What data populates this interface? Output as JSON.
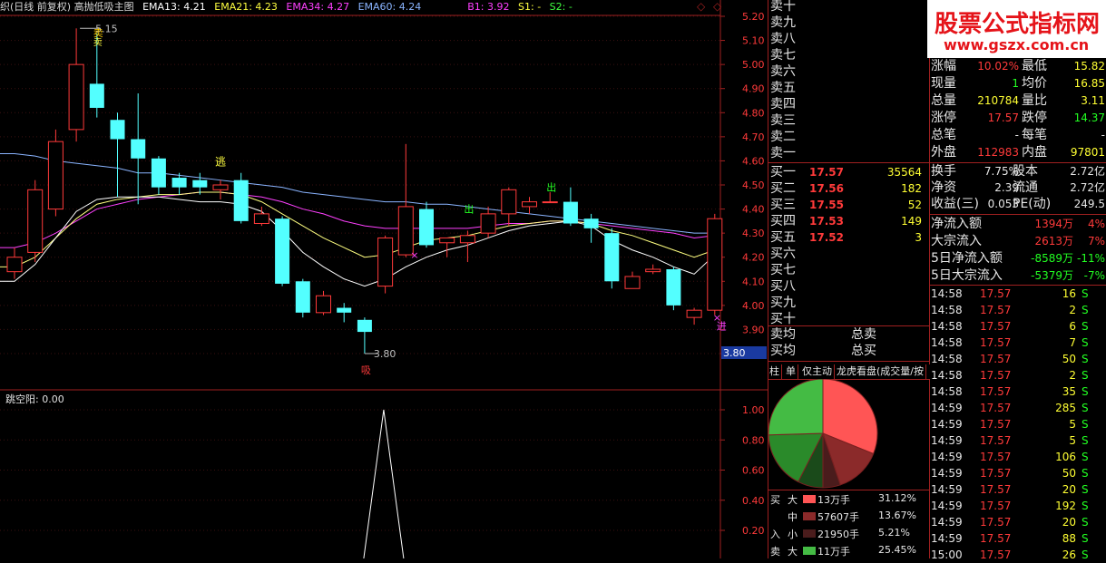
{
  "header": {
    "title": "织(日线 前复权) 高抛低吸主图",
    "indicators": [
      {
        "label": "EMA13: 4.21",
        "color": "#ffffff"
      },
      {
        "label": "EMA21: 4.23",
        "color": "#ffff40"
      },
      {
        "label": "EMA34: 4.27",
        "color": "#ff40ff"
      },
      {
        "label": "EMA60: 4.24",
        "color": "#8ab4ff"
      },
      {
        "label": "B1: 3.92",
        "color": "#ff40ff"
      },
      {
        "label": "S1: -",
        "color": "#ffff40"
      },
      {
        "label": "S2: -",
        "color": "#40ff40"
      }
    ],
    "diamond": "◇"
  },
  "price_axis": [
    "5.20",
    "5.10",
    "5.00",
    "4.90",
    "4.80",
    "4.70",
    "4.60",
    "4.50",
    "4.40",
    "4.30",
    "4.20",
    "4.10",
    "4.00",
    "3.90",
    "3.80"
  ],
  "current_price_tag": "3.80",
  "annotations": {
    "high_label": "5.15",
    "low_label": "3.80",
    "escape": "逃",
    "in_label": "进",
    "out1": "出",
    "out2": "出",
    "out3": "出",
    "sell_mark": "卖",
    "low_mark": "吸"
  },
  "lower": {
    "title": "跳空阳: 0.00",
    "axis": [
      "1.00",
      "0.80",
      "0.60",
      "0.40",
      "0.20"
    ]
  },
  "watermark": {
    "title": "股票公式指标网",
    "url": "www.gszx.com.cn"
  },
  "sell_labels": [
    "卖十",
    "卖九",
    "卖八",
    "卖七",
    "卖六",
    "卖五",
    "卖四",
    "卖三",
    "卖二",
    "卖一"
  ],
  "quote": [
    {
      "k1": "涨幅",
      "v1": "10.02%",
      "k2": "最低",
      "v2": "15.82"
    },
    {
      "k1": "现量",
      "v1": "1",
      "k2": "均价",
      "v2": "16.85"
    },
    {
      "k1": "总量",
      "v1": "210784",
      "k2": "量比",
      "v2": "3.11"
    },
    {
      "k1": "涨停",
      "v1": "17.57",
      "k2": "跌停",
      "v2": "14.37"
    },
    {
      "k1": "总笔",
      "v1": "-",
      "k2": "每笔",
      "v2": "-"
    },
    {
      "k1": "外盘",
      "v1": "112983",
      "k2": "内盘",
      "v2": "97801"
    }
  ],
  "buy_book": [
    {
      "label": "买一",
      "price": "17.57",
      "vol": "35564"
    },
    {
      "label": "买二",
      "price": "17.56",
      "vol": "182"
    },
    {
      "label": "买三",
      "price": "17.55",
      "vol": "52"
    },
    {
      "label": "买四",
      "price": "17.53",
      "vol": "149"
    },
    {
      "label": "买五",
      "price": "17.52",
      "vol": "3"
    }
  ],
  "buy_more": [
    "买六",
    "买七",
    "买八",
    "买九",
    "买十"
  ],
  "avg": {
    "sell_avg": "卖均",
    "total_sell": "总卖",
    "buy_avg": "买均",
    "total_buy": "总买"
  },
  "fundamentals": [
    {
      "k1": "换手",
      "v1": "7.75%",
      "k2": "股本",
      "v2": "2.72亿"
    },
    {
      "k1": "净资",
      "v1": "2.39",
      "k2": "流通",
      "v2": "2.72亿"
    },
    {
      "k1": "收益(三)",
      "v1": "0.053",
      "k2": "PE(动)",
      "v2": "249.5"
    }
  ],
  "flows": [
    {
      "label": "净流入额",
      "value": "1394万",
      "pct": "4%",
      "color": "#ff3a3a"
    },
    {
      "label": "大宗流入",
      "value": "2613万",
      "pct": "7%",
      "color": "#ff3a3a"
    },
    {
      "label": "5日净流入额",
      "value": "-8589万",
      "pct": "-11%",
      "color": "#22ff22"
    },
    {
      "label": "5日大宗流入",
      "value": "-5379万",
      "pct": "-7%",
      "color": "#22ff22"
    }
  ],
  "ticks": [
    {
      "t": "14:58",
      "p": "17.57",
      "v": "16",
      "s": "S"
    },
    {
      "t": "14:58",
      "p": "17.57",
      "v": "2",
      "s": "S"
    },
    {
      "t": "14:58",
      "p": "17.57",
      "v": "6",
      "s": "S"
    },
    {
      "t": "14:58",
      "p": "17.57",
      "v": "7",
      "s": "S"
    },
    {
      "t": "14:58",
      "p": "17.57",
      "v": "50",
      "s": "S"
    },
    {
      "t": "14:58",
      "p": "17.57",
      "v": "2",
      "s": "S"
    },
    {
      "t": "14:58",
      "p": "17.57",
      "v": "35",
      "s": "S"
    },
    {
      "t": "14:59",
      "p": "17.57",
      "v": "285",
      "s": "S"
    },
    {
      "t": "14:59",
      "p": "17.57",
      "v": "5",
      "s": "S"
    },
    {
      "t": "14:59",
      "p": "17.57",
      "v": "5",
      "s": "S"
    },
    {
      "t": "14:59",
      "p": "17.57",
      "v": "106",
      "s": "S"
    },
    {
      "t": "14:59",
      "p": "17.57",
      "v": "50",
      "s": "S"
    },
    {
      "t": "14:59",
      "p": "17.57",
      "v": "20",
      "s": "S"
    },
    {
      "t": "14:59",
      "p": "17.57",
      "v": "192",
      "s": "S"
    },
    {
      "t": "14:59",
      "p": "17.57",
      "v": "20",
      "s": "S"
    },
    {
      "t": "14:59",
      "p": "17.57",
      "v": "88",
      "s": "S"
    },
    {
      "t": "15:00",
      "p": "17.57",
      "v": "26",
      "s": "S"
    }
  ],
  "tabs": [
    "柱",
    "单",
    "仅主动",
    "龙虎看盘(成交量/按"
  ],
  "pie": {
    "slices": [
      {
        "label": "大买",
        "value": 31.12,
        "color": "#ff5555"
      },
      {
        "label": "中买",
        "value": 13.67,
        "color": "#8b2a2a"
      },
      {
        "label": "小买",
        "value": 5.21,
        "color": "#4a1c1c"
      },
      {
        "label": "小卖",
        "value": 7.5,
        "color": "#1a4a1a"
      },
      {
        "label": "中卖",
        "value": 17.05,
        "color": "#2a8a2a"
      },
      {
        "label": "大卖",
        "value": 25.45,
        "color": "#44bb44"
      }
    ]
  },
  "legend": {
    "side_buy": "买",
    "side_in": "入",
    "side_sell": "卖",
    "rows": [
      {
        "size": "大",
        "amount": "13万手",
        "pct": "31.12%",
        "color": "#ff5555"
      },
      {
        "size": "中",
        "amount": "57607手",
        "pct": "13.67%",
        "color": "#8b2a2a"
      },
      {
        "size": "小",
        "amount": "21950手",
        "pct": "5.21%",
        "color": "#4a1c1c"
      },
      {
        "size": "大",
        "amount": "11万手",
        "pct": "25.45%",
        "color": "#44bb44"
      }
    ]
  },
  "candles": [
    {
      "o": 4.14,
      "c": 4.2,
      "h": 4.24,
      "l": 4.11
    },
    {
      "o": 4.22,
      "c": 4.48,
      "h": 4.52,
      "l": 4.18
    },
    {
      "o": 4.4,
      "c": 4.68,
      "h": 4.73,
      "l": 4.37
    },
    {
      "o": 4.73,
      "c": 5.0,
      "h": 5.15,
      "l": 4.68
    },
    {
      "o": 4.92,
      "c": 4.82,
      "h": 5.13,
      "l": 4.78
    },
    {
      "o": 4.77,
      "c": 4.69,
      "h": 4.8,
      "l": 4.45
    },
    {
      "o": 4.69,
      "c": 4.61,
      "h": 4.88,
      "l": 4.42
    },
    {
      "o": 4.61,
      "c": 4.49,
      "h": 4.62,
      "l": 4.46
    },
    {
      "o": 4.53,
      "c": 4.49,
      "h": 4.55,
      "l": 4.46
    },
    {
      "o": 4.52,
      "c": 4.49,
      "h": 4.55,
      "l": 4.46
    },
    {
      "o": 4.48,
      "c": 4.5,
      "h": 4.52,
      "l": 4.44
    },
    {
      "o": 4.52,
      "c": 4.35,
      "h": 4.55,
      "l": 4.34
    },
    {
      "o": 4.34,
      "c": 4.38,
      "h": 4.41,
      "l": 4.33
    },
    {
      "o": 4.36,
      "c": 4.09,
      "h": 4.37,
      "l": 4.08
    },
    {
      "o": 4.1,
      "c": 3.97,
      "h": 4.11,
      "l": 3.95
    },
    {
      "o": 3.97,
      "c": 4.04,
      "h": 4.06,
      "l": 3.96
    },
    {
      "o": 3.99,
      "c": 3.97,
      "h": 4.01,
      "l": 3.93
    },
    {
      "o": 3.94,
      "c": 3.89,
      "h": 3.95,
      "l": 3.8
    },
    {
      "o": 4.08,
      "c": 4.28,
      "h": 4.29,
      "l": 4.05
    },
    {
      "o": 4.21,
      "c": 4.41,
      "h": 4.67,
      "l": 4.2
    },
    {
      "o": 4.4,
      "c": 4.25,
      "h": 4.43,
      "l": 4.24
    },
    {
      "o": 4.26,
      "c": 4.28,
      "h": 4.28,
      "l": 4.2
    },
    {
      "o": 4.26,
      "c": 4.29,
      "h": 4.31,
      "l": 4.18
    },
    {
      "o": 4.3,
      "c": 4.38,
      "h": 4.41,
      "l": 4.28
    },
    {
      "o": 4.38,
      "c": 4.48,
      "h": 4.49,
      "l": 4.33
    },
    {
      "o": 4.41,
      "c": 4.43,
      "h": 4.45,
      "l": 4.38
    },
    {
      "o": 4.43,
      "c": 4.43,
      "h": 4.47,
      "l": 4.43
    },
    {
      "o": 4.43,
      "c": 4.34,
      "h": 4.49,
      "l": 4.33
    },
    {
      "o": 4.36,
      "c": 4.32,
      "h": 4.38,
      "l": 4.26
    },
    {
      "o": 4.3,
      "c": 4.1,
      "h": 4.32,
      "l": 4.07
    },
    {
      "o": 4.07,
      "c": 4.12,
      "h": 4.14,
      "l": 4.07
    },
    {
      "o": 4.14,
      "c": 4.15,
      "h": 4.17,
      "l": 4.13
    },
    {
      "o": 4.15,
      "c": 4.0,
      "h": 4.16,
      "l": 3.98
    },
    {
      "o": 3.95,
      "c": 3.98,
      "h": 3.99,
      "l": 3.92
    },
    {
      "o": 3.98,
      "c": 4.36,
      "h": 4.38,
      "l": 3.96
    }
  ],
  "ma": {
    "ema60": [
      4.63,
      4.62,
      4.6,
      4.59,
      4.58,
      4.57,
      4.55,
      4.55,
      4.54,
      4.53,
      4.52,
      4.51,
      4.5,
      4.49,
      4.47,
      4.46,
      4.45,
      4.44,
      4.43,
      4.43,
      4.42,
      4.42,
      4.41,
      4.4,
      4.39,
      4.38,
      4.37,
      4.36,
      4.35,
      4.34,
      4.33,
      4.32,
      4.31,
      4.3,
      4.3
    ],
    "ema34": [
      4.24,
      4.26,
      4.3,
      4.35,
      4.4,
      4.42,
      4.44,
      4.45,
      4.46,
      4.47,
      4.47,
      4.46,
      4.45,
      4.43,
      4.4,
      4.38,
      4.35,
      4.33,
      4.32,
      4.32,
      4.32,
      4.32,
      4.32,
      4.33,
      4.34,
      4.34,
      4.35,
      4.35,
      4.34,
      4.33,
      4.32,
      4.31,
      4.3,
      4.28,
      4.29
    ],
    "ema21": [
      4.16,
      4.2,
      4.28,
      4.36,
      4.42,
      4.44,
      4.45,
      4.46,
      4.46,
      4.47,
      4.47,
      4.46,
      4.43,
      4.38,
      4.33,
      4.28,
      4.24,
      4.2,
      4.21,
      4.24,
      4.27,
      4.28,
      4.29,
      4.31,
      4.33,
      4.34,
      4.35,
      4.35,
      4.34,
      4.31,
      4.29,
      4.26,
      4.23,
      4.2,
      4.23
    ],
    "ema13": [
      4.1,
      4.17,
      4.28,
      4.39,
      4.44,
      4.45,
      4.45,
      4.45,
      4.44,
      4.43,
      4.43,
      4.42,
      4.39,
      4.31,
      4.22,
      4.16,
      4.11,
      4.08,
      4.11,
      4.16,
      4.2,
      4.23,
      4.25,
      4.28,
      4.31,
      4.33,
      4.34,
      4.35,
      4.33,
      4.27,
      4.23,
      4.2,
      4.16,
      4.13,
      4.21
    ]
  },
  "spike": {
    "x_index": 17,
    "value": 1.0
  }
}
